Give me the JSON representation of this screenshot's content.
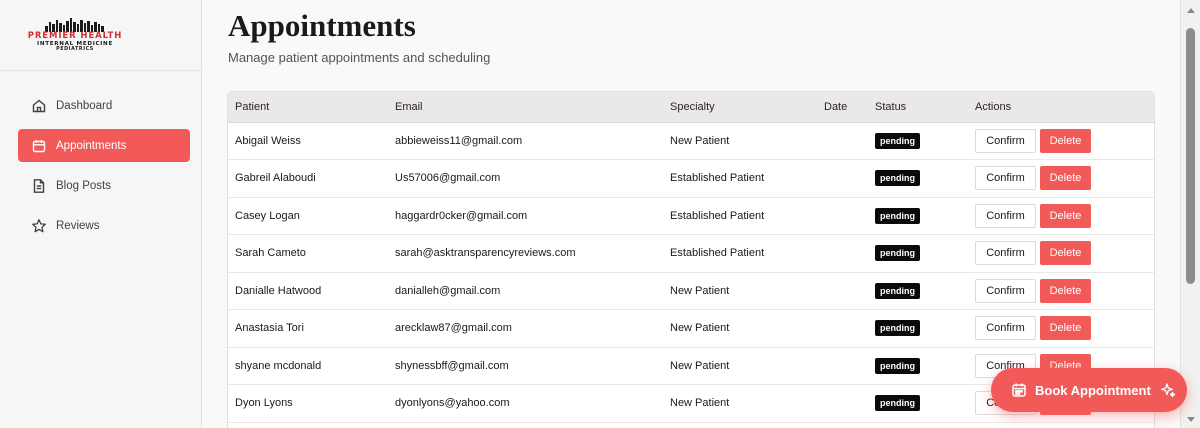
{
  "brand": {
    "line1": "PREMIER HEALTH",
    "line2": "INTERNAL MEDICINE",
    "line3": "PEDIATRICS",
    "accent": "#f25a5a"
  },
  "sidebar": {
    "items": [
      {
        "label": "Dashboard",
        "icon": "home-icon",
        "active": false
      },
      {
        "label": "Appointments",
        "icon": "calendar-icon",
        "active": true
      },
      {
        "label": "Blog Posts",
        "icon": "document-icon",
        "active": false
      },
      {
        "label": "Reviews",
        "icon": "star-icon",
        "active": false
      }
    ]
  },
  "page": {
    "title": "Appointments",
    "subtitle": "Manage patient appointments and scheduling"
  },
  "table": {
    "headers": [
      "Patient",
      "Email",
      "Specialty",
      "Date",
      "Status",
      "Actions"
    ],
    "rows": [
      {
        "patient": "Abigail Weiss",
        "email": "abbieweiss11@gmail.com",
        "specialty": "New Patient",
        "date": "",
        "status": "pending"
      },
      {
        "patient": "Gabreil Alaboudi",
        "email": "Us57006@gmail.com",
        "specialty": "Established Patient",
        "date": "",
        "status": "pending"
      },
      {
        "patient": "Casey Logan",
        "email": "haggardr0cker@gmail.com",
        "specialty": "Established Patient",
        "date": "",
        "status": "pending"
      },
      {
        "patient": "Sarah Cameto",
        "email": "sarah@asktransparencyreviews.com",
        "specialty": "Established Patient",
        "date": "",
        "status": "pending"
      },
      {
        "patient": "Danialle Hatwood",
        "email": "danialleh@gmail.com",
        "specialty": "New Patient",
        "date": "",
        "status": "pending"
      },
      {
        "patient": "Anastasia Tori",
        "email": "arecklaw87@gmail.com",
        "specialty": "New Patient",
        "date": "",
        "status": "pending"
      },
      {
        "patient": "shyane mcdonald",
        "email": "shynessbff@gmail.com",
        "specialty": "New Patient",
        "date": "",
        "status": "pending"
      },
      {
        "patient": "Dyon Lyons",
        "email": "dyonlyons@yahoo.com",
        "specialty": "New Patient",
        "date": "",
        "status": "pending"
      }
    ],
    "actions": {
      "confirm": "Confirm",
      "delete": "Delete"
    }
  },
  "fab": {
    "label": "Book Appointment",
    "icon": "calendar-icon",
    "trailing_icon": "sparkle-icon"
  }
}
